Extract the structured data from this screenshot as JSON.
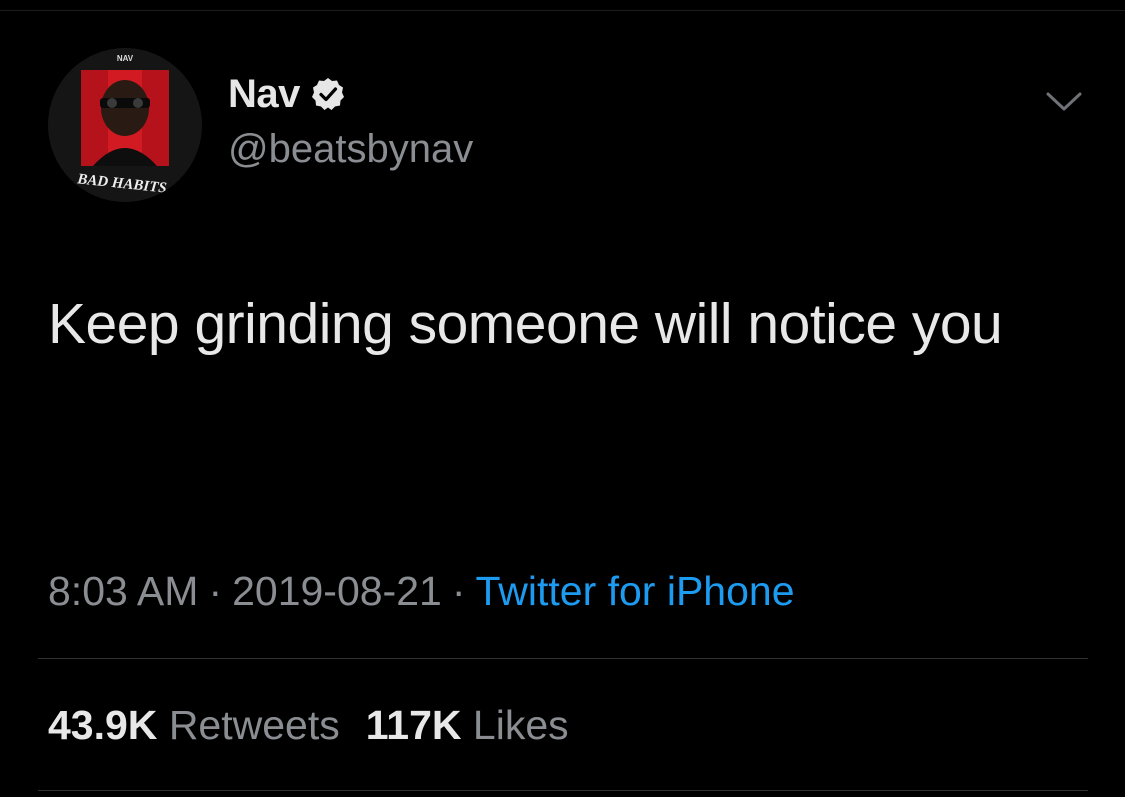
{
  "avatar": {
    "top_text": "NAV",
    "bottom_text": "BAD HABITS"
  },
  "user": {
    "display_name": "Nav",
    "handle": "@beatsbynav",
    "verified": true
  },
  "tweet": {
    "text": "Keep grinding someone will notice you"
  },
  "meta": {
    "time": "8:03 AM",
    "separator": "·",
    "date": "2019-08-21",
    "source": "Twitter for iPhone"
  },
  "stats": {
    "retweets_count": "43.9K",
    "retweets_label": "Retweets",
    "likes_count": "117K",
    "likes_label": "Likes"
  },
  "icons": {
    "verified": "verified-badge-icon",
    "menu": "chevron-down-icon"
  },
  "colors": {
    "background": "#000000",
    "link": "#1d9bf0",
    "secondary_text": "#8a8d91"
  }
}
